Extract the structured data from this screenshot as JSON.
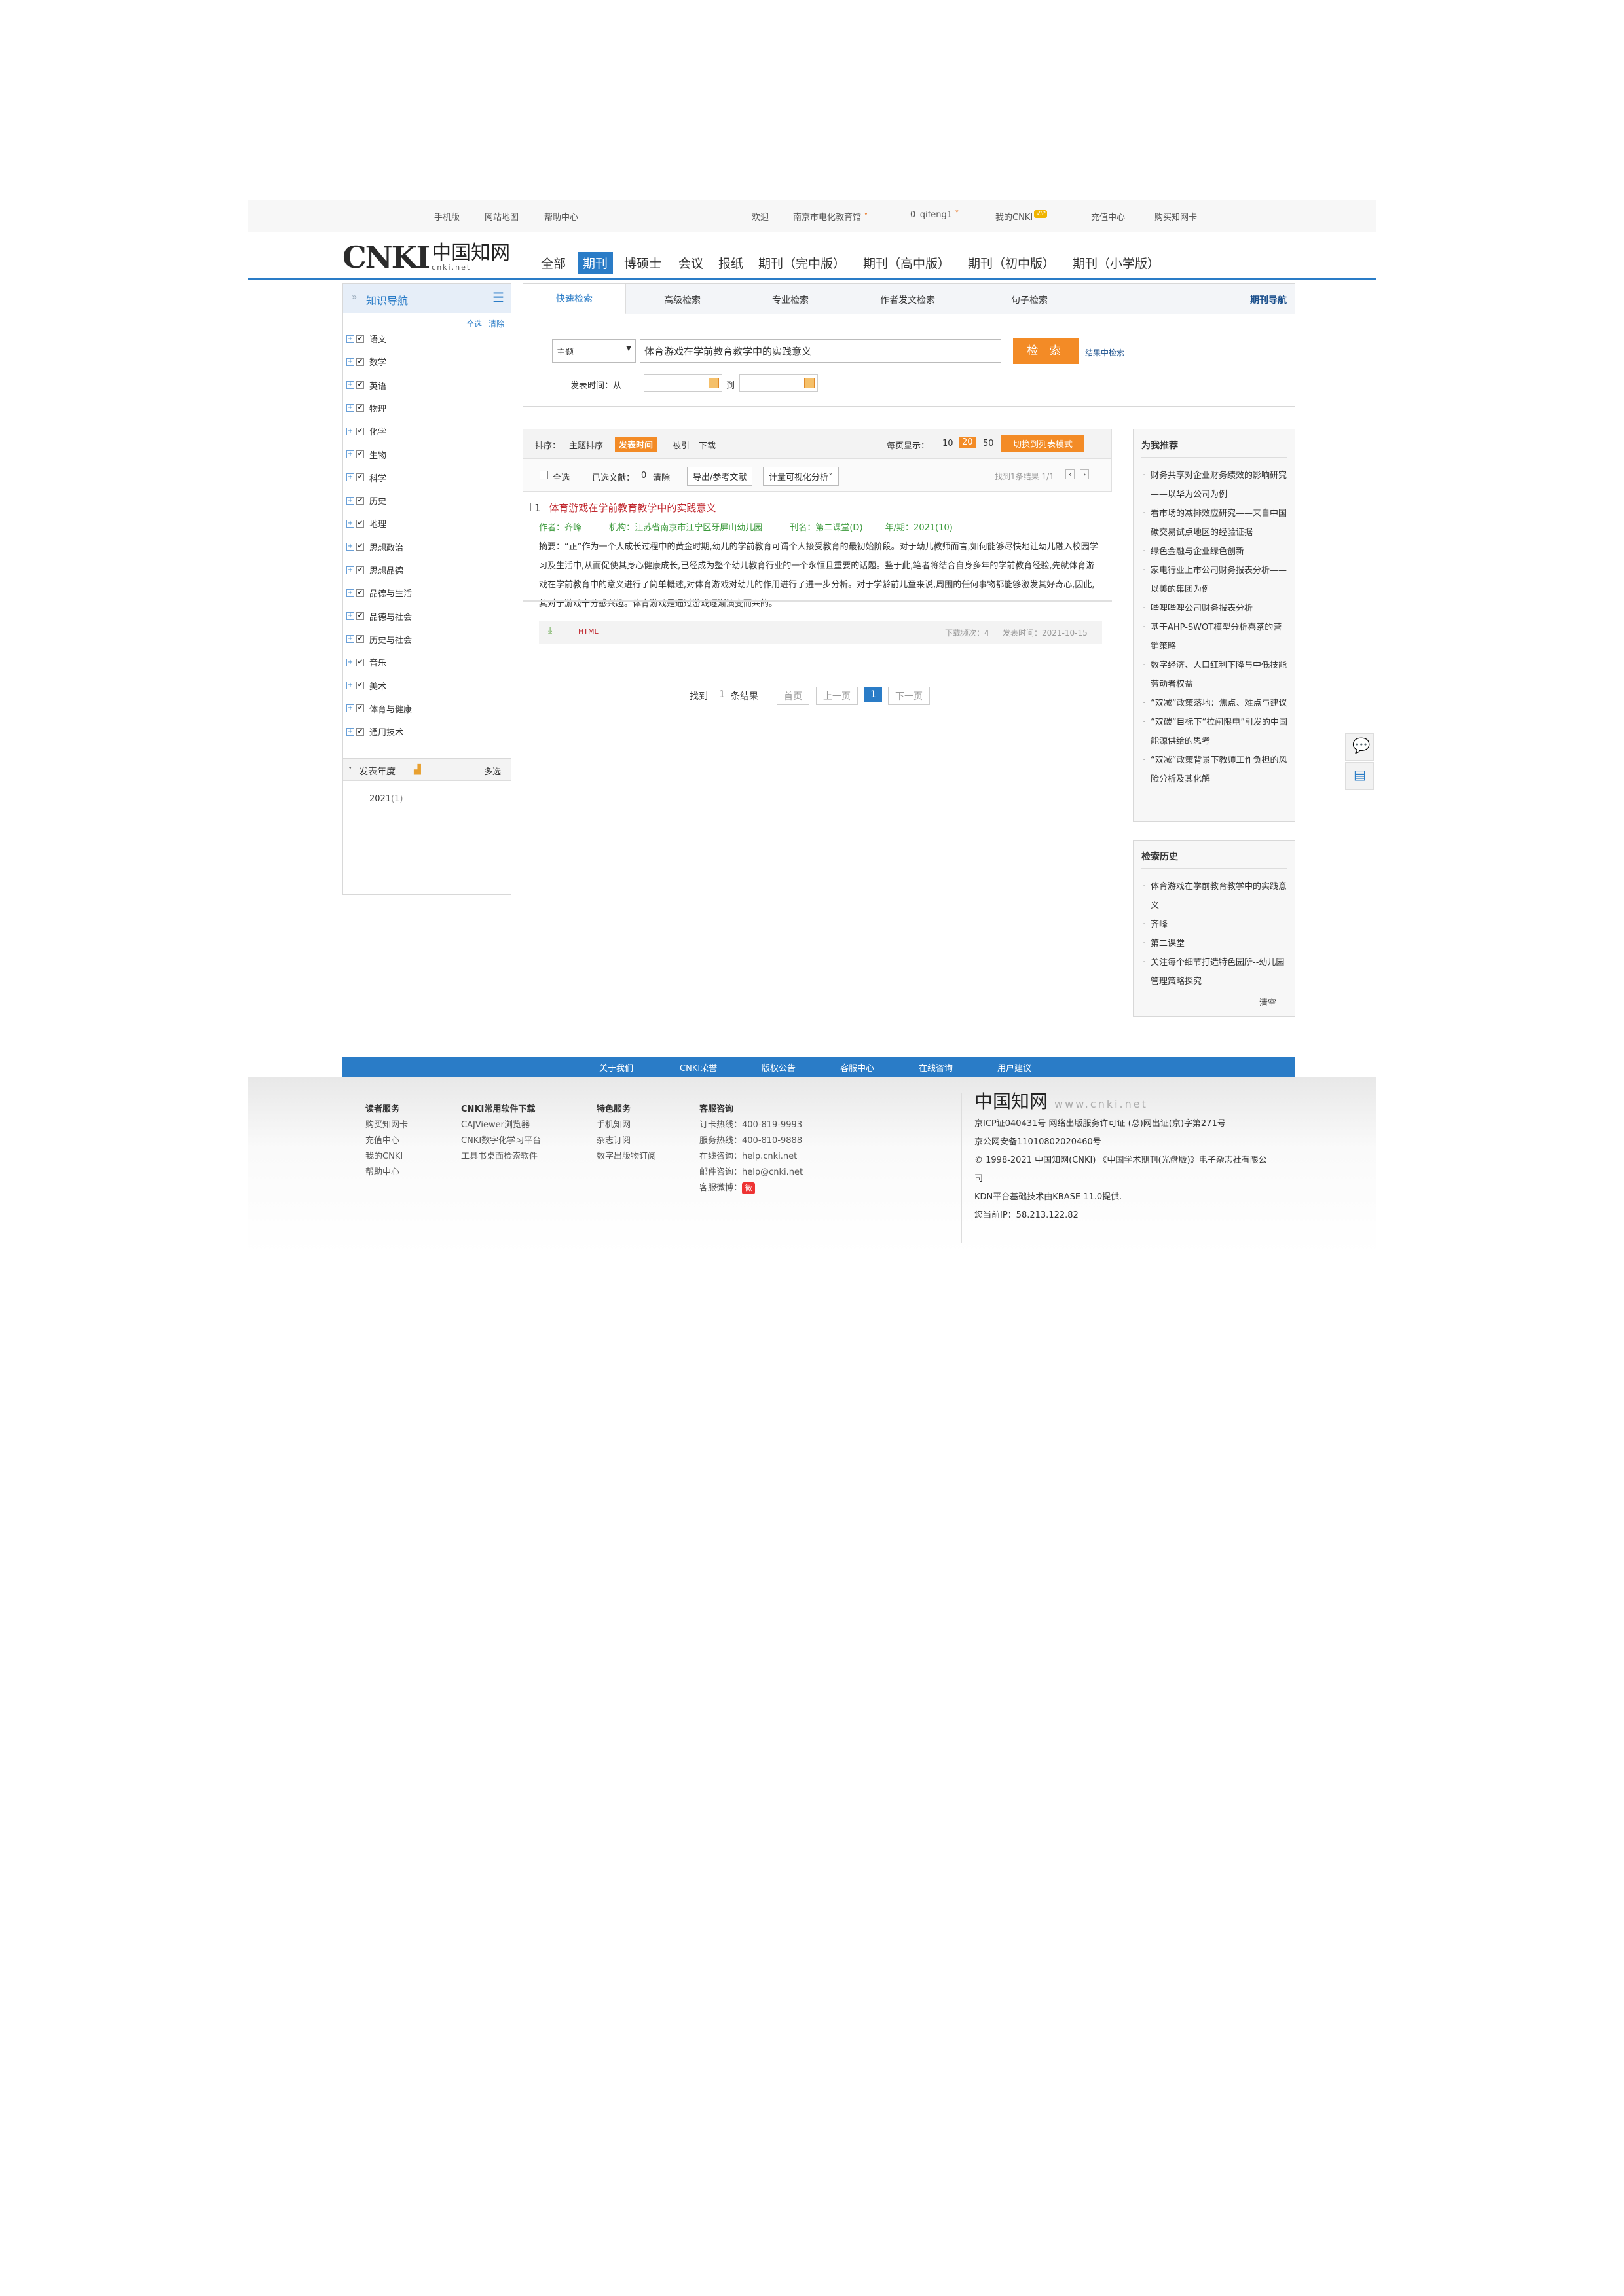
{
  "topbar": {
    "mobile": "手机版",
    "sitemap": "网站地图",
    "help": "帮助中心",
    "welcome": "欢迎",
    "org": "南京市电化教育馆",
    "user": "0_qifeng1",
    "mycnki": "我的CNKI",
    "vip": "VIP",
    "recharge": "充值中心",
    "buycard": "购买知网卡"
  },
  "header": {
    "logo_text": "CNKI",
    "logo_cn": "中国知网",
    "logo_url": "cnki.net",
    "tabs": [
      "全部",
      "期刊",
      "博硕士",
      "会议",
      "报纸",
      "期刊（完中版）",
      "期刊（高中版）",
      "期刊（初中版）",
      "期刊（小学版）"
    ]
  },
  "left": {
    "title": "知识导航",
    "select_all": "全选",
    "clear": "清除",
    "subjects": [
      "语文",
      "数学",
      "英语",
      "物理",
      "化学",
      "生物",
      "科学",
      "历史",
      "地理",
      "思想政治",
      "思想品德",
      "品德与生活",
      "品德与社会",
      "历史与社会",
      "音乐",
      "美术",
      "体育与健康",
      "通用技术"
    ],
    "year_title": "发表年度",
    "year_multi": "多选",
    "year_item": "2021",
    "year_count": "(1)"
  },
  "search": {
    "tabs": [
      "快速检索",
      "高级检索",
      "专业检索",
      "作者发文检索",
      "句子检索"
    ],
    "journal_nav": "期刊导航",
    "field": "主题",
    "query": "体育游戏在学前教育教学中的实践意义",
    "button": "检 索",
    "in_results": "结果中检索",
    "pub_time": "发表时间：从",
    "to": "到"
  },
  "sort": {
    "label": "排序：",
    "theme": "主题排序",
    "pubtime": "发表时间",
    "cited": "被引",
    "downloads": "下载",
    "per_page": "每页显示：",
    "n10": "10",
    "n20": "20",
    "n50": "50",
    "switch": "切换到列表模式"
  },
  "toolbar": {
    "select_all": "全选",
    "selected": "已选文献：",
    "selected_count": "0",
    "clear": "清除",
    "export": "导出/参考文献",
    "analysis": "计量可视化分析",
    "found": "找到1条结果  1/1"
  },
  "result": {
    "num": "1",
    "title": "体育游戏在学前教育教学中的实践意义",
    "author_label": "作者：",
    "author": "齐峰",
    "org_label": "机构：",
    "org": "江苏省南京市江宁区牙屏山幼儿园",
    "journal_label": "刊名：",
    "journal": "第二课堂(D)",
    "year_label": "年/期：",
    "year": "2021(10)",
    "abstract": "摘要：“正”作为一个人成长过程中的黄金时期,幼儿的学前教育可谓个人接受教育的最初始阶段。对于幼儿教师而言,如何能够尽快地让幼儿融入校园学习及生活中,从而促使其身心健康成长,已经成为整个幼儿教育行业的一个永恒且重要的话题。鉴于此,笔者将结合自身多年的学前教育经验,先就体育游戏在学前教育中的意义进行了简单概述,对体育游戏对幼儿的作用进行了进一步分析。对于学龄前儿童来说,周围的任何事物都能够激发其好奇心,因此,其对于游戏十分感兴趣。体育游戏是通过游戏逐渐演变而来的。",
    "html": "HTML",
    "downloads": "下载频次：4",
    "pubdate": "发表时间：2021-10-15"
  },
  "pager": {
    "found": "找到",
    "count": "1",
    "unit": "条结果",
    "first": "首页",
    "prev": "上一页",
    "cur": "1",
    "next": "下一页"
  },
  "recommend": {
    "title": "为我推荐",
    "items": [
      "财务共享对企业财务绩效的影响研究——以华为公司为例",
      "看市场的减排效应研究——来自中国碳交易试点地区的经验证据",
      "绿色金融与企业绿色创新",
      "家电行业上市公司财务报表分析——以美的集团为例",
      "哔哩哔哩公司财务报表分析",
      "基于AHP-SWOT模型分析喜茶的营销策略",
      "数字经济、人口红利下降与中低技能劳动者权益",
      "“双减”政策落地：焦点、难点与建议",
      "“双碳”目标下“拉闸限电”引发的中国能源供给的思考",
      "“双减”政策背景下教师工作负担的风险分析及其化解"
    ]
  },
  "history": {
    "title": "检索历史",
    "items": [
      "体育游戏在学前教育教学中的实践意义",
      "齐峰",
      "第二课堂",
      "关注每个细节打造特色园所--幼儿园管理策略探究"
    ],
    "clear": "清空"
  },
  "footnav": [
    "关于我们",
    "CNKI荣誉",
    "版权公告",
    "客服中心",
    "在线咨询",
    "用户建议"
  ],
  "footer": {
    "col1": {
      "h": "读者服务",
      "items": [
        "购买知网卡",
        "充值中心",
        "我的CNKI",
        "帮助中心"
      ]
    },
    "col2": {
      "h": "CNKI常用软件下载",
      "items": [
        "CAJViewer浏览器",
        "CNKI数字化学习平台",
        "工具书桌面检索软件"
      ]
    },
    "col3": {
      "h": "特色服务",
      "items": [
        "手机知网",
        "杂志订阅",
        "数字出版物订阅"
      ]
    },
    "col4": {
      "h": "客服咨询",
      "items": [
        "订卡热线：400-819-9993",
        "服务热线：400-810-9888",
        "在线咨询：help.cnki.net",
        "邮件咨询：help@cnki.net",
        "客服微博："
      ]
    },
    "logo": "中国知网",
    "logo_url": "www.cnki.net",
    "lines": [
      "京ICP证040431号 网络出版服务许可证 (总)网出证(京)字第271号",
      "京公网安备11010802020460号",
      "© 1998-2021 中国知网(CNKI) 《中国学术期刊(光盘版)》电子杂志社有限公司",
      "KDN平台基础技术由KBASE 11.0提供.",
      "您当前IP：58.213.122.82"
    ]
  },
  "colors": {
    "brand_blue": "#2a7cc7",
    "orange": "#f38b26",
    "title_red": "#c0262d",
    "meta_green": "#3c9a3c"
  }
}
